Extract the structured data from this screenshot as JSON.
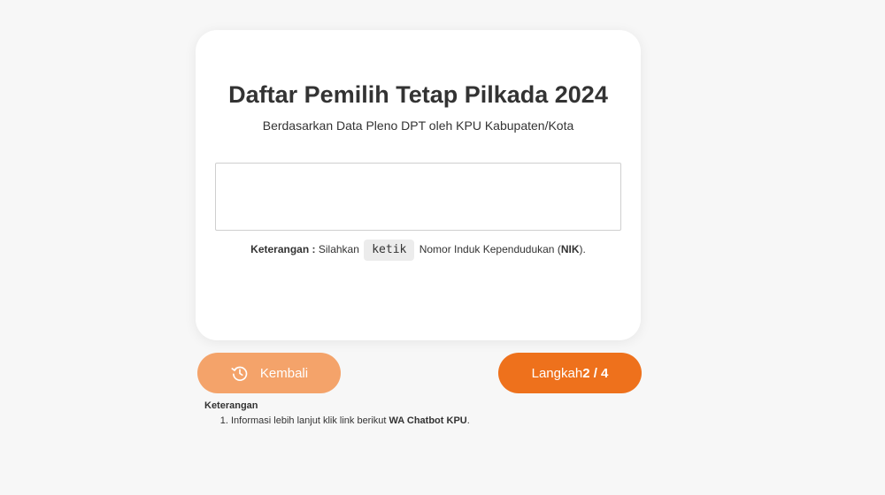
{
  "card": {
    "title": "Daftar Pemilih Tetap Pilkada 2024",
    "subtitle": "Berdasarkan Data Pleno DPT oleh KPU Kabupaten/Kota",
    "nik_input": {
      "value": "",
      "placeholder": ""
    },
    "note": {
      "label": "Keterangan :",
      "text_before": " Silahkan ",
      "key": "ketik",
      "text_middle": " Nomor Induk Kependudukan (",
      "nik": "NIK",
      "text_after": ")."
    }
  },
  "buttons": {
    "back_label": "Kembali",
    "back_icon": "history-icon",
    "next_prefix": "Langkah ",
    "next_step": "2 / 4"
  },
  "footer": {
    "title": "Keterangan",
    "items": [
      {
        "text": "Informasi lebih lanjut klik link berikut ",
        "link": "WA Chatbot KPU",
        "suffix": "."
      }
    ]
  },
  "colors": {
    "back_button": "#f4a36a",
    "next_button": "#ee711c",
    "background": "#f7f7f7"
  }
}
